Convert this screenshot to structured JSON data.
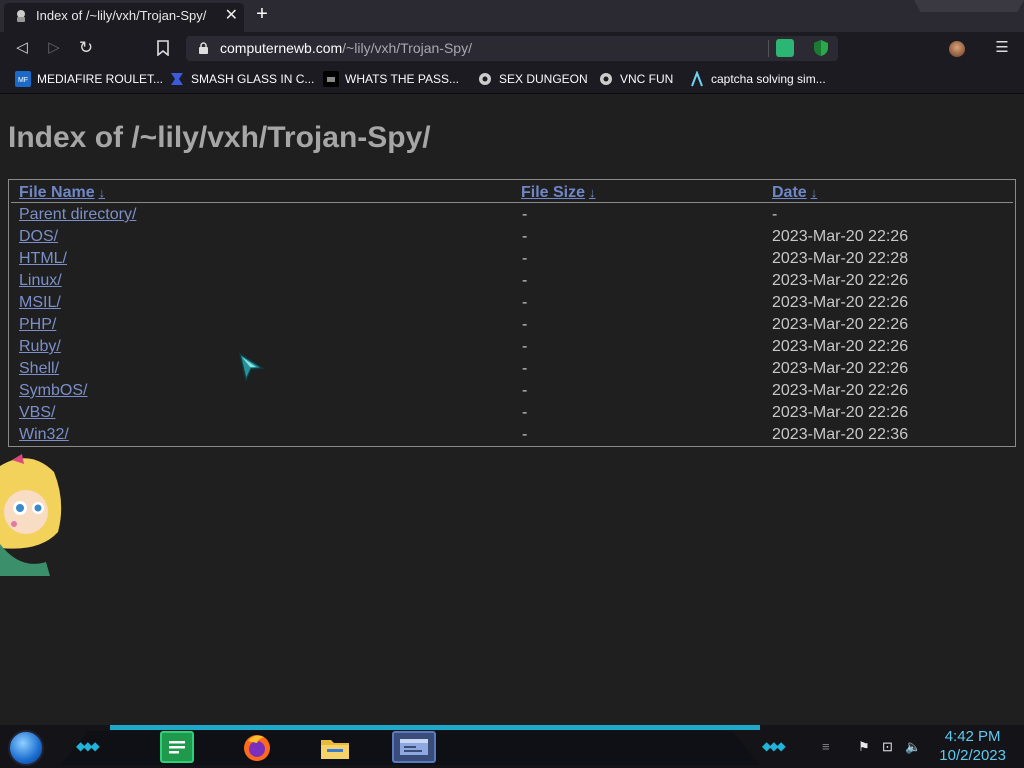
{
  "tab": {
    "title": "Index of /~lily/vxh/Trojan-Spy/",
    "close": "✕",
    "new": "+"
  },
  "nav": {
    "back": "◁",
    "forward": "▷",
    "reload": "↻",
    "bookmark": "🔖",
    "menu": "☰"
  },
  "url": {
    "host": "computernewb.com",
    "path": "/~lily/vxh/Trojan-Spy/"
  },
  "bookmarks": [
    {
      "label": "MEDIAFIRE ROULET...",
      "icon": "mediafire-icon"
    },
    {
      "label": "SMASH GLASS IN C...",
      "icon": "smash-glass-icon"
    },
    {
      "label": "WHATS THE PASS...",
      "icon": "dark-site-icon"
    },
    {
      "label": "SEX DUNGEON",
      "icon": "gear-site-icon"
    },
    {
      "label": "VNC FUN",
      "icon": "gear-site-icon"
    },
    {
      "label": "captcha solving sim...",
      "icon": "lambda-icon"
    }
  ],
  "page": {
    "title": "Index of /~lily/vxh/Trojan-Spy/",
    "columns": {
      "name": "File Name",
      "size": "File Size",
      "date": "Date",
      "sort_arrow": "↓"
    },
    "rows": [
      {
        "name": "Parent directory/",
        "size": "-",
        "date": "-"
      },
      {
        "name": "DOS/",
        "size": "-",
        "date": "2023-Mar-20 22:26"
      },
      {
        "name": "HTML/",
        "size": "-",
        "date": "2023-Mar-20 22:28"
      },
      {
        "name": "Linux/",
        "size": "-",
        "date": "2023-Mar-20 22:26"
      },
      {
        "name": "MSIL/",
        "size": "-",
        "date": "2023-Mar-20 22:26"
      },
      {
        "name": "PHP/",
        "size": "-",
        "date": "2023-Mar-20 22:26"
      },
      {
        "name": "Ruby/",
        "size": "-",
        "date": "2023-Mar-20 22:26"
      },
      {
        "name": "Shell/",
        "size": "-",
        "date": "2023-Mar-20 22:26"
      },
      {
        "name": "SymbOS/",
        "size": "-",
        "date": "2023-Mar-20 22:26"
      },
      {
        "name": "VBS/",
        "size": "-",
        "date": "2023-Mar-20 22:26"
      },
      {
        "name": "Win32/",
        "size": "-",
        "date": "2023-Mar-20 22:36"
      }
    ]
  },
  "taskbar": {
    "time": "4:42 PM",
    "date": "10/2/2023"
  },
  "colors": {
    "link": "#7c8fc9",
    "accent": "#1fa9c9",
    "clock": "#5fc9f0"
  }
}
